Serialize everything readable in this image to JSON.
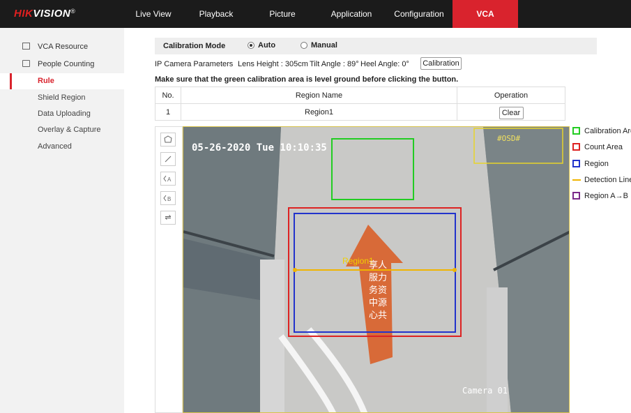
{
  "brand": {
    "logo_red": "HIK",
    "logo_white": "VISION",
    "logo_mark": "®"
  },
  "nav": {
    "tabs": [
      {
        "label": "Live View"
      },
      {
        "label": "Playback"
      },
      {
        "label": "Picture"
      },
      {
        "label": "Application"
      },
      {
        "label": "Configuration"
      },
      {
        "label": "VCA"
      }
    ],
    "active": "VCA"
  },
  "sidebar": {
    "items": [
      {
        "label": "VCA Resource",
        "icon": "monitor-icon"
      },
      {
        "label": "People Counting",
        "icon": "people-counting-icon"
      },
      {
        "label": "Rule",
        "active": true
      },
      {
        "label": "Shield Region"
      },
      {
        "label": "Data Uploading"
      },
      {
        "label": "Overlay & Capture"
      },
      {
        "label": "Advanced"
      }
    ]
  },
  "calibration": {
    "mode_label": "Calibration Mode",
    "auto_label": "Auto",
    "manual_label": "Manual",
    "selected": "Auto",
    "params_label": "IP Camera Parameters",
    "lens_height": "Lens Height : 305cm",
    "tilt_angle": "Tilt Angle : 89°",
    "heel_angle": "Heel Angle: 0°",
    "button_label": "Calibration",
    "note": "Make sure that the green calibration area is level ground before clicking the button."
  },
  "region_table": {
    "headers": [
      "No.",
      "Region Name",
      "Operation"
    ],
    "rows": [
      {
        "no": "1",
        "name": "Region1",
        "action": "Clear"
      }
    ]
  },
  "tools": [
    "polygon-tool-icon",
    "line-tool-icon",
    "region-a-tool-icon",
    "region-b-tool-icon",
    "swap-direction-icon"
  ],
  "tool_glyphs": {
    "a": "A",
    "b": "B",
    "swap": "⇌"
  },
  "video": {
    "timestamp": "05-26-2020 Tue 10:10:35",
    "osd": "#OSD#",
    "camera": "Camera 01",
    "region_label": "Region1",
    "sign_text": [
      "享",
      "人",
      "服",
      "力",
      "务",
      "资",
      "中",
      "源",
      "心",
      "共"
    ]
  },
  "legend": {
    "items": [
      {
        "label": "Calibration Area",
        "color": "#22cc22",
        "kind": "box"
      },
      {
        "label": "Count Area",
        "color": "#dd2222",
        "kind": "box"
      },
      {
        "label": "Region",
        "color": "#2233cc",
        "kind": "box"
      },
      {
        "label": "Detection Line",
        "color": "#f0b400",
        "kind": "line"
      },
      {
        "label": "Region A→B",
        "color": "#7a2a8a",
        "kind": "box"
      }
    ]
  },
  "colors": {
    "brand_red": "#d9232d",
    "topbar": "#1b1b1b"
  }
}
